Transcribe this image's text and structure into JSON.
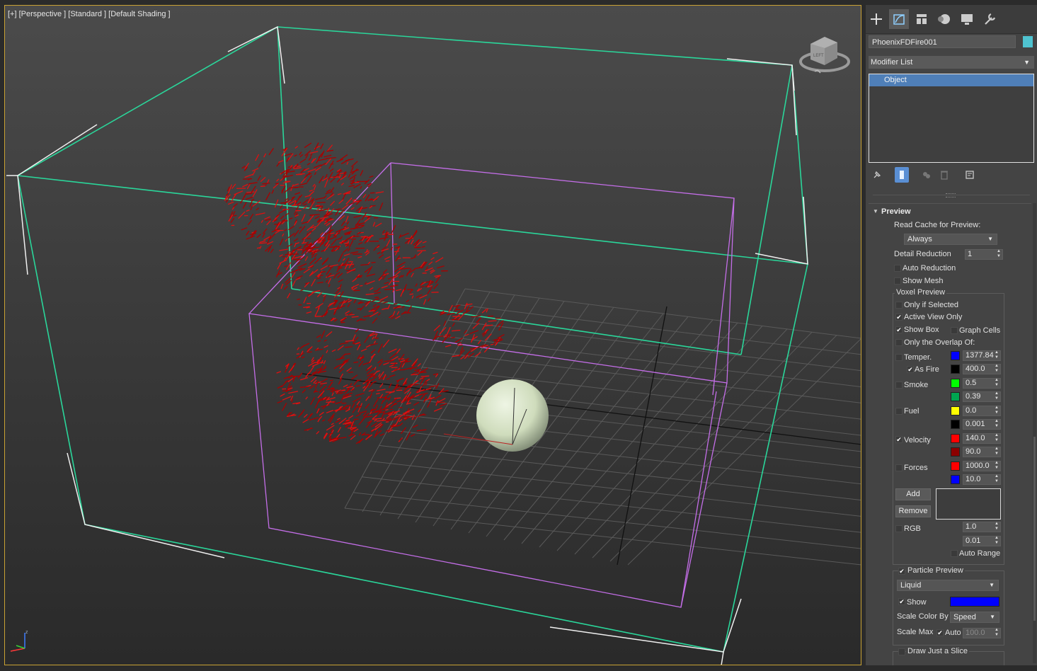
{
  "viewport": {
    "label": "[+] [Perspective ] [Standard ] [Default Shading ]",
    "viewcube_face": "LEFT"
  },
  "command_panel": {
    "tabs": [
      "create-icon",
      "modify-icon",
      "hierarchy-icon",
      "motion-icon",
      "display-icon",
      "utilities-icon"
    ],
    "active_tab": "modify",
    "object_name": "PhoenixFDFire001",
    "object_color": "#4fc3d0",
    "modifier_list": "Modifier List",
    "stack_items": [
      "Object"
    ]
  },
  "preview": {
    "title": "Preview",
    "read_cache_label": "Read Cache for Preview:",
    "read_cache_value": "Always",
    "detail_reduction_label": "Detail Reduction",
    "detail_reduction_value": "1",
    "auto_reduction": "Auto Reduction",
    "show_mesh": "Show Mesh",
    "voxel_preview": {
      "title": "Voxel Preview",
      "only_if_selected": "Only if Selected",
      "active_view_only": "Active View Only",
      "show_box": "Show Box",
      "graph_cells": "Graph Cells",
      "only_overlap": "Only the Overlap Of:",
      "temper": {
        "label": "Temper.",
        "color": "#0000ff",
        "value": "1377.84"
      },
      "as_fire": {
        "label": "As Fire",
        "color": "#000000",
        "value": "400.0"
      },
      "smoke": {
        "label": "Smoke",
        "color1": "#00ff00",
        "value1": "0.5",
        "color2": "#00a550",
        "value2": "0.39"
      },
      "fuel": {
        "label": "Fuel",
        "color1": "#ffff00",
        "value1": "0.0",
        "color2": "#000000",
        "value2": "0.001"
      },
      "velocity": {
        "label": "Velocity",
        "color1": "#ff0000",
        "value1": "140.0",
        "color2": "#8b0000",
        "value2": "90.0"
      },
      "forces": {
        "label": "Forces",
        "color1": "#ff0000",
        "value1": "1000.0",
        "color2": "#0000ff",
        "value2": "10.0"
      },
      "add": "Add",
      "remove": "Remove",
      "rgb": {
        "label": "RGB",
        "value1": "1.0",
        "value2": "0.01"
      },
      "auto_range": "Auto Range"
    },
    "particle_preview": {
      "title": "Particle Preview",
      "type": "Liquid",
      "show": "Show",
      "show_color": "#0000ff",
      "scale_color_by_label": "Scale Color By",
      "scale_color_by_value": "Speed",
      "scale_max_label": "Scale Max",
      "auto": "Auto",
      "scale_max_value": "100.0"
    },
    "draw_slice": "Draw Just a Slice"
  }
}
